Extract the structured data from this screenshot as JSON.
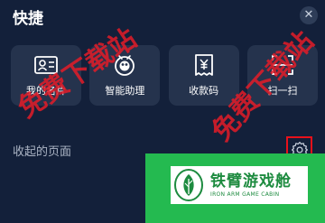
{
  "header": {
    "title": "快捷",
    "close_icon": "close-icon"
  },
  "shortcuts": [
    {
      "label": "我的名片",
      "icon": "id-card-icon"
    },
    {
      "label": "智能助理",
      "icon": "assistant-icon"
    },
    {
      "label": "收款码",
      "icon": "yuan-receipt-icon"
    },
    {
      "label": "扫一扫",
      "icon": "scan-icon"
    }
  ],
  "collapsed_section": {
    "title": "收起的页面",
    "settings_icon": "gear-icon"
  },
  "watermarks": [
    "免费下载站",
    "免费下载站"
  ],
  "banner": {
    "name_cn": "铁臂游戏舱",
    "name_en": "IRON ARM GAME CABIN"
  },
  "colors": {
    "background": "#13203a",
    "card": "#25334d",
    "highlight_border": "#e8111a",
    "watermark": "#e41c28",
    "banner_green": "#24ba50"
  }
}
